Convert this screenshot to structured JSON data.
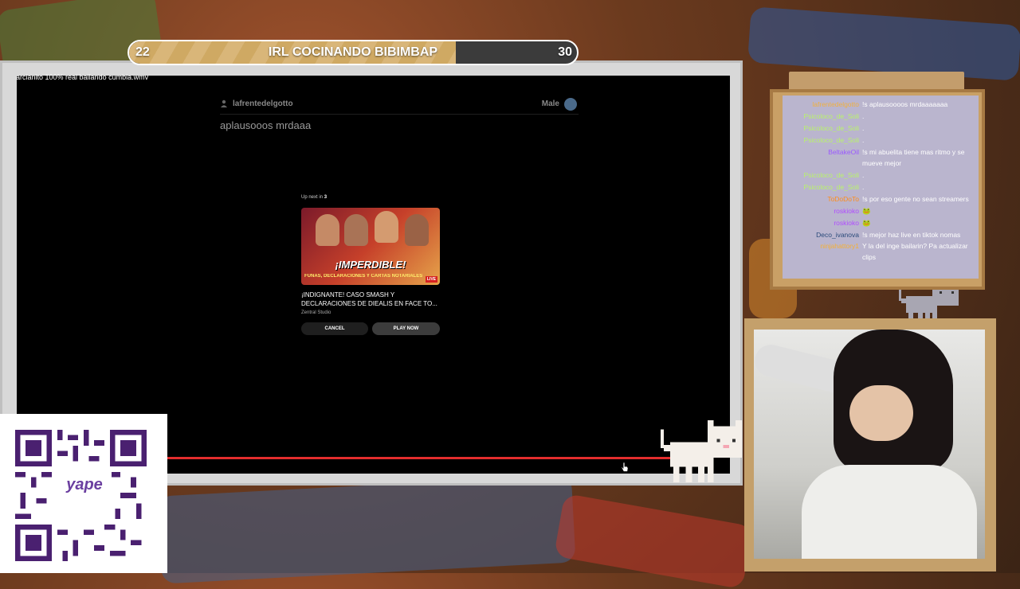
{
  "goal_bar": {
    "start": "22",
    "end": "30",
    "title": "IRL COCINANDO BIBIMBAP",
    "progress": 0.73
  },
  "screen": {
    "filename": "arcianito 100% real bailando cumbia.wmv",
    "chat_user": "lafrentedelgotto",
    "chat_role": "Male",
    "chat_message": "aplausooos mrdaaa"
  },
  "upnext": {
    "label": "Up next in",
    "countdown": "3",
    "thumb_headline": "¡IMPERDIBLE!",
    "thumb_sub": "FUNAS, DECLARACIONES Y CARTAS NOTARIALES",
    "thumb_live": "LIVE",
    "video_title": "¡INDIGNANTE! CASO SMASH Y DECLARACIONES DE DIEALIS EN FACE TO...",
    "channel": "Zentral Studio",
    "cancel": "CANCEL",
    "play_now": "PLAY NOW"
  },
  "qr": {
    "logo_text": "yape"
  },
  "chat": [
    {
      "user": "lafrentedelgotto",
      "color": "#f0b040",
      "msg": "!s aplausoooos mrdaaaaaaa"
    },
    {
      "user": "Psicoloco_de_Soli",
      "color": "#b9f36b",
      "msg": "."
    },
    {
      "user": "Psicoloco_de_Soli",
      "color": "#b9f36b",
      "msg": "."
    },
    {
      "user": "Psicoloco_de_Soli",
      "color": "#b9f36b",
      "msg": "."
    },
    {
      "user": "BeltakeOil",
      "color": "#9b59ff",
      "msg": "!s mi abuelita tiene mas ritmo y se mueve mejor"
    },
    {
      "user": "Psicoloco_de_Soli",
      "color": "#b9f36b",
      "msg": "."
    },
    {
      "user": "Psicoloco_de_Soli",
      "color": "#b9f36b",
      "msg": "."
    },
    {
      "user": "ToDoDoTo",
      "color": "#ff8c1a",
      "msg": "!s por eso gente no sean streamers"
    },
    {
      "user": "roskioko",
      "color": "#b04cff",
      "msg": "🐸"
    },
    {
      "user": "roskioko",
      "color": "#b04cff",
      "msg": "🐸"
    },
    {
      "user": "Deco_ivanova",
      "color": "#2a4a7a",
      "msg": "!s mejor haz live en tiktok nomas"
    },
    {
      "user": "ninjahattory1",
      "color": "#f5b035",
      "msg": "Y la del inge bailarin? Pa actualizar clips"
    }
  ]
}
